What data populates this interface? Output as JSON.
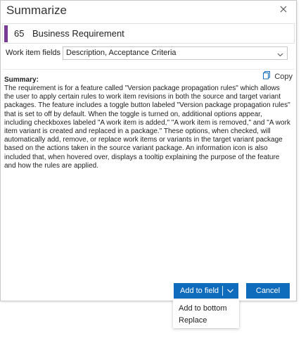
{
  "dialog": {
    "title": "Summarize",
    "close_icon": "close-icon"
  },
  "work_item": {
    "id": "65",
    "title": "Business Requirement",
    "type_color": "#773b93"
  },
  "fields": {
    "label": "Work item fields",
    "value": "Description, Acceptance Criteria"
  },
  "summary": {
    "heading": "Summary:",
    "copy_label": "Copy",
    "text": "The requirement is for a feature called \"Version package propagation rules\" which allows the user to apply certain rules to work item revisions in both the source and target variant packages. The feature includes a toggle button labeled \"Version package propagation rules\" that is set to off by default. When the toggle is turned on, additional options appear, including checkboxes labeled \"A work item is added,\" \"A work item is removed,\" and \"A work item variant is created and replaced in a package.\" These options, when checked, will automatically add, remove, or replace work items or variants in the target variant package based on the actions taken in the source variant package. An information icon is also included that, when hovered over, displays a tooltip explaining the purpose of the feature and how the rules are applied."
  },
  "actions": {
    "add_label": "Add to field",
    "cancel_label": "Cancel",
    "primary_color": "#0f6cbd"
  },
  "add_menu": {
    "items": [
      "Add to bottom",
      "Replace"
    ]
  }
}
